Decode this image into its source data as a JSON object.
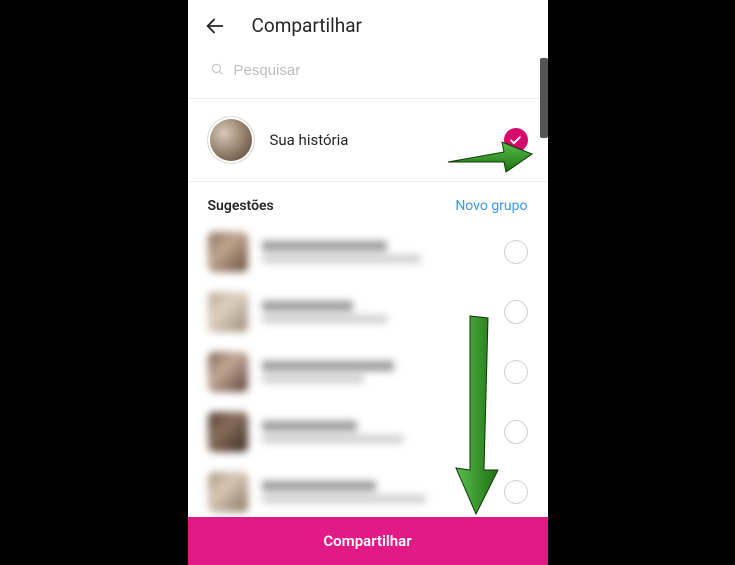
{
  "header": {
    "title": "Compartilhar"
  },
  "search": {
    "placeholder": "Pesquisar"
  },
  "story": {
    "label": "Sua história"
  },
  "suggestions": {
    "title": "Sugestões",
    "new_group": "Novo grupo"
  },
  "share_button": {
    "label": "Compartilhar"
  },
  "colors": {
    "accent": "#d6086b",
    "link": "#3897f0",
    "share_bg": "#e11a86",
    "annotation_arrow": "#2e8b1a"
  }
}
